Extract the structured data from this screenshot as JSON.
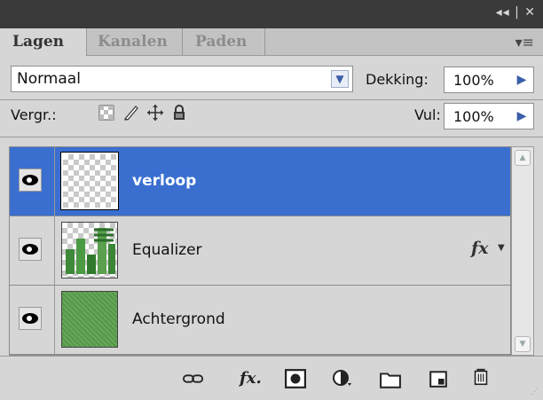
{
  "titlebar": {
    "controls": "◂◂ | ✕"
  },
  "tabs": [
    {
      "label": "Lagen"
    },
    {
      "label": "Kanalen"
    },
    {
      "label": "Paden"
    }
  ],
  "blend_mode": {
    "value": "Normaal"
  },
  "opacity": {
    "label": "Dekking:",
    "value": "100%"
  },
  "lock": {
    "label": "Vergr.:",
    "icons": [
      "lock-transparent-pixels-icon",
      "lock-image-pixels-icon",
      "lock-position-icon",
      "lock-all-icon"
    ]
  },
  "fill": {
    "label": "Vul:",
    "value": "100%"
  },
  "layers": [
    {
      "name": "verloop",
      "selected": true,
      "thumbnail": "transparent"
    },
    {
      "name": "Equalizer",
      "selected": false,
      "thumbnail": "equalizer",
      "fx": "fx"
    },
    {
      "name": "Achtergrond",
      "selected": false,
      "thumbnail": "green-texture"
    }
  ],
  "bottom_icons": [
    "link-layers-icon",
    "layer-style-fx-icon",
    "layer-mask-icon",
    "adjustment-layer-icon",
    "new-group-icon",
    "new-layer-icon",
    "delete-layer-icon"
  ],
  "colors": {
    "selection": "#3a6fd0",
    "panel": "#d6d6d6",
    "titlebar": "#3a3a3a"
  }
}
